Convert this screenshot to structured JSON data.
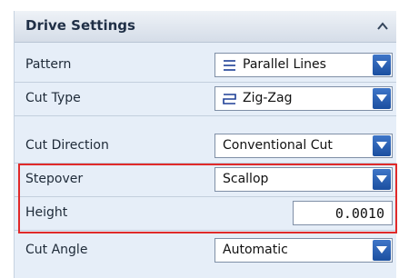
{
  "header": {
    "title": "Drive Settings",
    "collapse_icon": "chevron-up-icon"
  },
  "rows": {
    "pattern": {
      "label": "Pattern",
      "value": "Parallel Lines",
      "icon": "parallel-lines-icon"
    },
    "cut_type": {
      "label": "Cut Type",
      "value": "Zig-Zag",
      "icon": "zigzag-icon"
    },
    "cut_direction": {
      "label": "Cut Direction",
      "value": "Conventional Cut"
    },
    "stepover": {
      "label": "Stepover",
      "value": "Scallop"
    },
    "height": {
      "label": "Height",
      "value": "0.0010"
    },
    "cut_angle": {
      "label": "Cut Angle",
      "value": "Automatic"
    }
  },
  "colors": {
    "highlight": "#e02a2a",
    "dropdown_button": "#2a5fb5",
    "panel_bg": "#e6eef8"
  }
}
